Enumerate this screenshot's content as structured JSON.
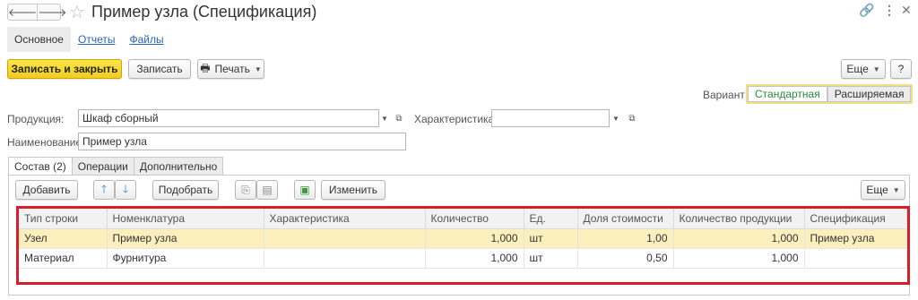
{
  "window": {
    "title": "Пример узла (Спецификация)"
  },
  "icons": {
    "back": "arrow-left-icon",
    "forward": "arrow-right-icon",
    "star": "star-icon",
    "link": "link-icon",
    "menu": "more-vertical-icon",
    "close": "close-icon",
    "print": "printer-icon",
    "up": "arrow-up-icon",
    "down": "arrow-down-icon",
    "copy": "copy-icon",
    "paste": "paste-icon",
    "image": "picture-icon"
  },
  "nav_tabs": [
    "Основное",
    "Отчеты",
    "Файлы"
  ],
  "toolbar": {
    "save_close": "Записать и закрыть",
    "save": "Записать",
    "print": "Печать",
    "more": "Еще",
    "help": "?"
  },
  "variant": {
    "label": "Вариант:",
    "standard": "Стандартная",
    "extended": "Расширяемая"
  },
  "form": {
    "product_label": "Продукция:",
    "product_value": "Шкаф сборный",
    "characteristic_label": "Характеристика:",
    "characteristic_value": "",
    "name_label": "Наименование:",
    "name_value": "Пример узла"
  },
  "tabs": [
    "Состав (2)",
    "Операции",
    "Дополнительно"
  ],
  "table_toolbar": {
    "add": "Добавить",
    "pick": "Подобрать",
    "change": "Изменить",
    "more": "Еще"
  },
  "table": {
    "columns": [
      "Тип строки",
      "Номенклатура",
      "Характеристика",
      "Количество",
      "Ед.",
      "Доля стоимости",
      "Количество продукции",
      "Спецификация"
    ],
    "rows": [
      [
        "Узел",
        "Пример узла",
        "",
        "1,000",
        "шт",
        "1,00",
        "1,000",
        "Пример узла"
      ],
      [
        "Материал",
        "Фурнитура",
        "",
        "1,000",
        "шт",
        "0,50",
        "1,000",
        ""
      ]
    ]
  },
  "colors": {
    "primary_button": "#f5d321",
    "highlight_row": "#fbf0bd",
    "annotation_border": "#d61f2d",
    "link": "#2a64b0",
    "variant_active": "#2a8b3c"
  }
}
